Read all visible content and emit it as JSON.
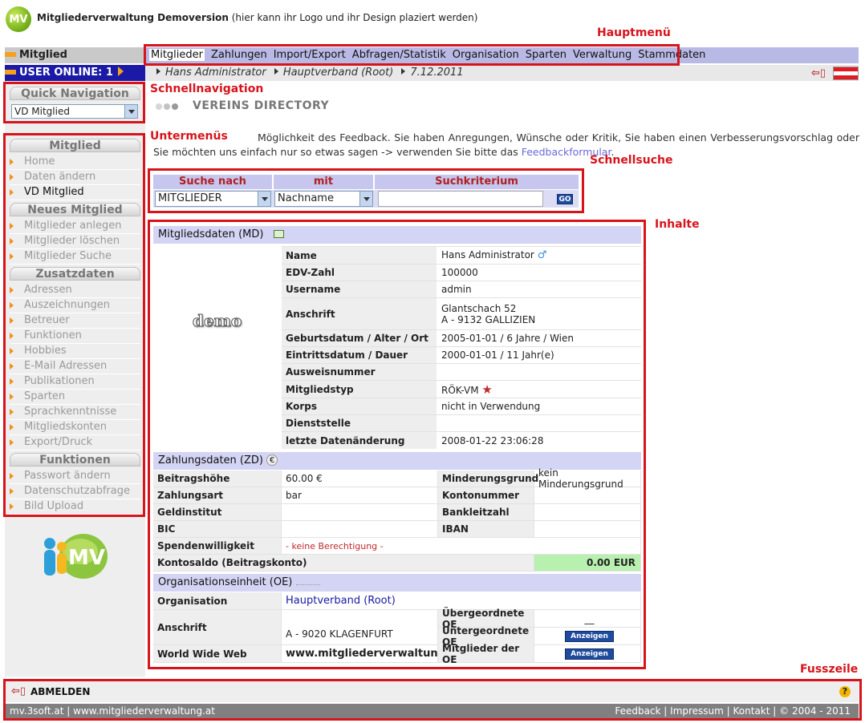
{
  "app": {
    "logo": "MV",
    "title_bold": "Mitgliederverwaltung Demoversion",
    "title_rest": " (hier kann ihr Logo und ihr Design plaziert werden)"
  },
  "annotations": {
    "hauptmenu": "Hauptmenü",
    "schnellnavigation": "Schnellnavigation",
    "untermenus": "Untermenüs",
    "schnellsuche": "Schnellsuche",
    "inhalte": "Inhalte",
    "fusszeile": "Fusszeile"
  },
  "left_header": {
    "section": "Mitglied",
    "user_online": "USER ONLINE: 1"
  },
  "menu": [
    "Mitglieder",
    "Zahlungen",
    "Import/Export",
    "Abfragen/Statistik",
    "Organisation",
    "Sparten",
    "Verwaltung",
    "Stammdaten"
  ],
  "breadcrumb": [
    "Hans Administrator",
    "Hauptverband (Root)",
    "7.12.2011"
  ],
  "quick_nav": {
    "title": "Quick Navigation",
    "selected": "VD Mitglied"
  },
  "sidebar": {
    "groups": [
      {
        "title": "Mitglied",
        "items": [
          "Home",
          "Daten ändern",
          "VD Mitglied"
        ]
      },
      {
        "title": "Neues Mitglied",
        "items": [
          "Mitglieder anlegen",
          "Mitglieder löschen",
          "Mitglieder Suche"
        ]
      },
      {
        "title": "Zusatzdaten",
        "items": [
          "Adressen",
          "Auszeichnungen",
          "Betreuer",
          "Funktionen",
          "Hobbies",
          "E-Mail Adressen",
          "Publikationen",
          "Sparten",
          "Sprachkenntnisse",
          "Mitgliedskonten",
          "Export/Druck"
        ]
      },
      {
        "title": "Funktionen",
        "items": [
          "Passwort ändern",
          "Datenschutzabfrage",
          "Bild Upload"
        ]
      }
    ],
    "logo": "MV"
  },
  "content": {
    "title": "VEREINS DIRECTORY",
    "feedback_text": "Möglichkeit des Feedback. Sie haben Anregungen, Wünsche oder Kritik, Sie haben einen Verbesserungsvorschlag oder Sie möchten uns einfach nur so etwas sagen -> verwenden Sie bitte das ",
    "feedback_link": "Feedbackformular",
    "feedback_end": "."
  },
  "quick_search": {
    "headers": [
      "Suche nach",
      "mit",
      "Suchkriterium"
    ],
    "search_for": "MITGLIEDER",
    "with": "Nachname",
    "criteria": "",
    "go": "GO"
  },
  "member_data": {
    "title": "Mitgliedsdaten (MD)",
    "photo_label": "demo",
    "rows": [
      {
        "label": "Name",
        "value": "Hans Administrator"
      },
      {
        "label": "EDV-Zahl",
        "value": "100000"
      },
      {
        "label": "Username",
        "value": "admin"
      },
      {
        "label": "Anschrift",
        "value": "Glantschach 52",
        "value2": "A - 9132 GALLIZIEN"
      },
      {
        "label": "Geburtsdatum / Alter / Ort",
        "value": "2005-01-01 / 6 Jahre / Wien"
      },
      {
        "label": "Eintrittsdatum / Dauer",
        "value": "2000-01-01 / 11 Jahr(e)"
      },
      {
        "label": "Ausweisnummer",
        "value": ""
      },
      {
        "label": "Mitgliedstyp",
        "value": "RÖK-VM"
      },
      {
        "label": "Korps",
        "value": "nicht in Verwendung"
      },
      {
        "label": "Dienststelle",
        "value": ""
      },
      {
        "label": "letzte Datenänderung",
        "value": "2008-01-22 23:06:28"
      }
    ]
  },
  "payment_data": {
    "title": "Zahlungsdaten (ZD)",
    "rows": [
      [
        "Beitragshöhe",
        "60.00 €",
        "Minderungsgrund",
        "kein Minderungsgrund"
      ],
      [
        "Zahlungsart",
        "bar",
        "Kontonummer",
        ""
      ],
      [
        "Geldinstitut",
        "",
        "Bankleitzahl",
        ""
      ],
      [
        "BIC",
        "",
        "IBAN",
        ""
      ]
    ],
    "donation_label": "Spendenwilligkeit",
    "donation_value": "- keine Berechtigung -",
    "balance_label": "Kontosaldo (Beitragskonto)",
    "balance_value": "0.00 EUR"
  },
  "org_data": {
    "title": "Organisationseinheit (OE)",
    "org_label": "Organisation",
    "org_value": "Hauptverband (Root)",
    "address_label": "Anschrift",
    "address_value": "A - 9020 KLAGENFURT",
    "parent_label": "Übergeordnete OE",
    "parent_value": "__",
    "child_label": "Untergeordnete OE",
    "www_label": "World Wide Web",
    "www_value": "www.mitgliederverwaltung.at",
    "members_label": "Mitglieder der OE",
    "show_button": "Anzeigen"
  },
  "footer": {
    "logout": "ABMELDEN",
    "left_text": "mv.3soft.at | www.mitgliederverwaltung.at",
    "links": [
      "Feedback",
      "Impressum",
      "Kontakt"
    ],
    "copyright": "© 2004 - 2011"
  }
}
